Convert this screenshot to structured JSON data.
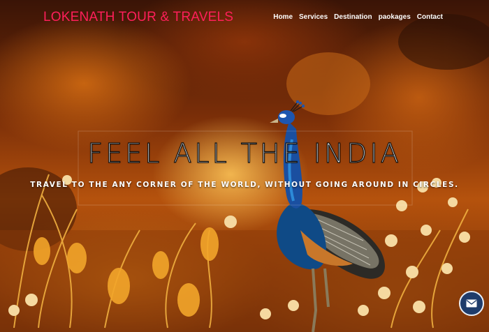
{
  "brand": {
    "name": "LOKENATH TOUR & TRAVELS"
  },
  "nav": {
    "items": [
      {
        "label": "Home"
      },
      {
        "label": "Services"
      },
      {
        "label": "Destination"
      },
      {
        "label": "paokages"
      },
      {
        "label": "Contact"
      }
    ]
  },
  "hero": {
    "headline": "FEEL ALL THE INDIA",
    "tagline": "TRAVEL TO THE ANY CORNER OF THE WORLD, WITHOUT GOING AROUND IN CIRCLES."
  },
  "mail_button": {
    "icon": "envelope-icon"
  },
  "colors": {
    "brand": "#ff1f5a",
    "nav_text": "#ffffff",
    "mail_button": "#1f3c6b"
  }
}
